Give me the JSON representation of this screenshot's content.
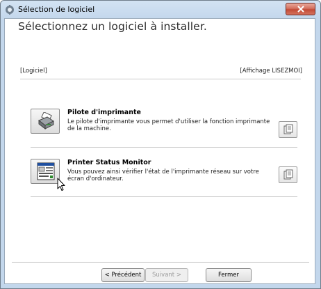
{
  "window": {
    "title": "Sélection de logiciel",
    "close_icon": "close-icon"
  },
  "main": {
    "heading": "Sélectionnez un logiciel à installer.",
    "section_left": "[Logiciel]",
    "section_right": "[Affichage LISEZMOI]",
    "items": [
      {
        "title": "Pilote d'imprimante",
        "desc_line1": "Le pilote d'imprimante vous permet d'utiliser la fonction imprimante",
        "desc_line2": "de la machine.",
        "icon": "printer-driver-icon",
        "readme_icon": "readme-icon"
      },
      {
        "title": "Printer Status Monitor",
        "desc_line1": "Vous pouvez ainsi vérifier l'état de l'imprimante réseau sur votre",
        "desc_line2": "écran d'ordinateur.",
        "icon": "status-monitor-icon",
        "readme_icon": "readme-icon"
      }
    ]
  },
  "footer": {
    "back_label": "< Précédent",
    "next_label": "Suivant >",
    "close_label": "Fermer"
  },
  "colors": {
    "title_bar": "#c3d7ec",
    "close_button": "#c24a36"
  }
}
